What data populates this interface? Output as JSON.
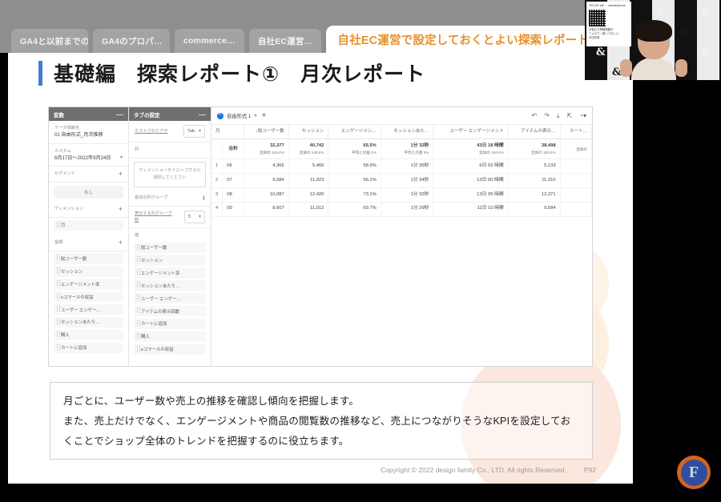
{
  "browser": {
    "tabs": [
      {
        "label": "GA4と以前までの…",
        "active": false
      },
      {
        "label": "GA4のプロパ…",
        "active": false
      },
      {
        "label": "commerce…",
        "active": false
      },
      {
        "label": "自社EC運営…",
        "active": false
      },
      {
        "label": "自社EC運営で設定しておくとよい探索レポート",
        "active": true
      }
    ]
  },
  "slide": {
    "heading": "基礎編　探索レポート①　月次レポート",
    "accent_color": "#3f7fd0",
    "active_tab_color": "#e8912a",
    "description": [
      "月ごとに、ユーザー数や売上の推移を確認し傾向を把握します。",
      "また、売上だけでなく、エンゲージメントや商品の閲覧数の推移など、売上につながりそうなKPIを設定してお",
      "くことでショップ全体のトレンドを把握するのに役立ちます。"
    ],
    "footer": {
      "copyright": "Copyright © 2022 design family Co., LTD. All rights Reserved.",
      "page": "P92"
    }
  },
  "ga4": {
    "variables_panel": {
      "title": "変数",
      "collapse": "—",
      "data_exploration_label": "データ探索名",
      "data_exploration_value": "01 自由形式_月次推移",
      "date_label": "カスタム",
      "date_value": "6月17日～2022年9月24日",
      "segment_label": "セグメント",
      "segment_value": "なし",
      "dimension_label": "ディメンション",
      "dimension_chips": [
        "月"
      ],
      "metric_label": "指標",
      "metric_chips": [
        "総ユーザー数",
        "セッション",
        "エンゲージメント率",
        "eコマースの収益",
        "ユーザー エンゲー…",
        "セッションあたり…",
        "購入",
        "カートに追加"
      ]
    },
    "tab_settings_panel": {
      "title": "タブの設定",
      "collapse": "—",
      "visualization_label": "ホストされたデザ",
      "visualization_value": "Tab",
      "columns_label": "列",
      "dropzone_text": "ディメンションをドロップするか選択してください",
      "start_row_label": "最初の列グループ",
      "start_row_value": "1",
      "show_rows_label": "表示する列グループ数",
      "show_rows_value": "5",
      "values_label": "値",
      "value_chips": [
        "総ユーザー数",
        "セッション",
        "エンゲージメント率",
        "セッションあたり…",
        "ユーザー エンゲー…",
        "アイテムの表示回数",
        "カートに追加",
        "購入",
        "eコマースの収益"
      ]
    },
    "report": {
      "tab_name": "自由形式 1",
      "add_tab": "+",
      "toolbar_icons": [
        "undo-icon",
        "redo-icon",
        "download-icon",
        "share-icon",
        "help-icon"
      ],
      "columns": [
        "月",
        "↓総ユーザー数",
        "セッション",
        "エンゲージメン…",
        "セッションあた…",
        "ユーザー エンゲージメント",
        "アイテムの表示…",
        "カート…"
      ],
      "total_row": {
        "label": "合計",
        "cells": [
          {
            "main": "32,377",
            "sub": "全体の 100.0%"
          },
          {
            "main": "40,742",
            "sub": "全体の 100.0%"
          },
          {
            "main": "65.5%",
            "sub": "平均との差 0%"
          },
          {
            "main": "1分 32秒",
            "sub": "平均との差 0%"
          },
          {
            "main": "43日 18 時間",
            "sub": "全体の 100.0%"
          },
          {
            "main": "38,498",
            "sub": "全体の 100.0%"
          },
          {
            "main": "",
            "sub": "全体の"
          }
        ]
      },
      "rows": [
        {
          "index": "1",
          "dim": "06",
          "cells": [
            "4,365",
            "5,465",
            "58.5%",
            "1分 36秒",
            "6日 02 時間",
            "5,133",
            ""
          ]
        },
        {
          "index": "2",
          "dim": "07",
          "cells": [
            "9,584",
            "11,923",
            "56.1%",
            "1分 34秒",
            "13日 00 時間",
            "11,310",
            ""
          ]
        },
        {
          "index": "3",
          "dim": "08",
          "cells": [
            "10,087",
            "12,420",
            "73.1%",
            "1分 32秒",
            "13日 05 時間",
            "12,371",
            ""
          ]
        },
        {
          "index": "4",
          "dim": "09",
          "cells": [
            "8,607",
            "11,012",
            "69.7%",
            "1分 29秒",
            "11日 10 時間",
            "9,684",
            ""
          ]
        }
      ]
    }
  },
  "webcam": {
    "card_line1": "YES,OK WE ・ #deviantbomb",
    "card_line2": "お役立ち情報掲載中",
    "card_line3": "フォロワー募ってほしい",
    "card_line4": "中田志事",
    "backdrop_glyph": "&"
  },
  "logo": {
    "mark": "F"
  }
}
